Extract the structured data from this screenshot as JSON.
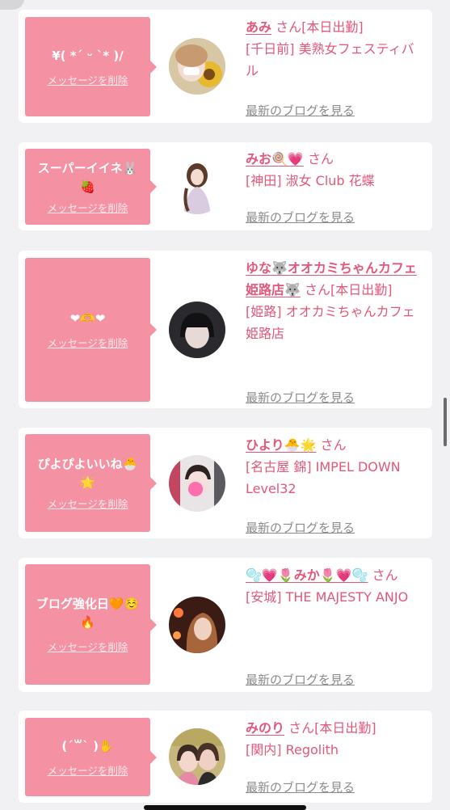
{
  "colors": {
    "accent": "#e3577a",
    "bubble": "#f491a3",
    "background": "#f1f1f3",
    "link_gray": "#8b8b8b"
  },
  "common": {
    "delete_label": "メッセージを削除",
    "blog_label": "最新のブログを見る",
    "san": "さん"
  },
  "cards": [
    {
      "message": "¥( *´ ᵕ `* )/",
      "name": "あみ",
      "status": "[本日出勤]",
      "shop": "[千日前] 美熟女フェスティバル"
    },
    {
      "message": "スーパーイイネ🐰🍓",
      "name": "みお🍭💗",
      "status": "",
      "shop": "[神田] 淑女 Club 花蝶"
    },
    {
      "message": "❤🫶❤",
      "name": "ゆな🐺オオカミちゃんカフェ姫路店🐺",
      "status": "[本日出勤]",
      "shop": "[姫路] オオカミちゃんカフェ姫路店"
    },
    {
      "message": "ぴよぴよいいね🐣🌟",
      "name": "ひより🐣🌟",
      "status": "",
      "shop": "[名古屋 錦] IMPEL DOWN Level32"
    },
    {
      "message": "ブログ強化日🧡☺️🔥",
      "name": "🫧💗🌷みか🌷💗🫧",
      "status": "",
      "shop": "[安城] THE MAJESTY ANJO"
    },
    {
      "message": "(´꒳` )✋",
      "name": "みのり",
      "status": "[本日出勤]",
      "shop": "[関内] Regolith"
    }
  ]
}
